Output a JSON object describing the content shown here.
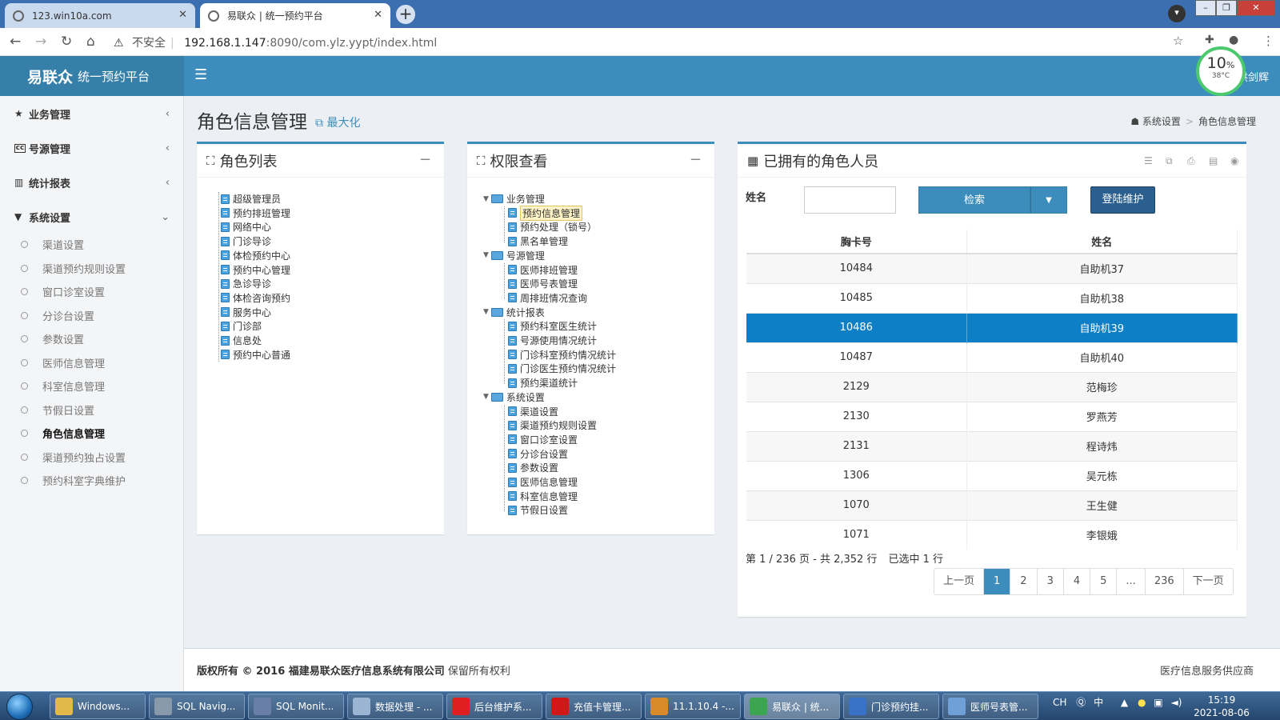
{
  "browser": {
    "tabs": [
      {
        "label": "123.win10a.com"
      },
      {
        "label": "易联众 | 统一预约平台"
      }
    ],
    "new_tab": "+",
    "security": "不安全",
    "url_host": "192.168.1.147",
    "url_path": ":8090/com.ylz.yypt/index.html"
  },
  "app": {
    "logo_bold": "易联众",
    "logo_sub": "统一预约平台",
    "user_name": "洪剑辉",
    "cpu_percent": "10",
    "cpu_percent_unit": "%",
    "cpu_temp": "38°C"
  },
  "sidebar": {
    "menus": [
      {
        "label": "业务管理",
        "icon": "star-icon"
      },
      {
        "label": "号源管理",
        "icon": "cc-icon"
      },
      {
        "label": "统计报表",
        "icon": "bar-chart-icon"
      },
      {
        "label": "系统设置",
        "icon": "filter-icon"
      }
    ],
    "submenu": [
      "渠道设置",
      "渠道预约规则设置",
      "窗口诊室设置",
      "分诊台设置",
      "参数设置",
      "医师信息管理",
      "科室信息管理",
      "节假日设置",
      "角色信息管理",
      "渠道预约独占设置",
      "预约科室字典维护"
    ],
    "active_submenu": "角色信息管理"
  },
  "page": {
    "title": "角色信息管理",
    "maximize": "最大化",
    "breadcrumb": [
      "系统设置",
      "角色信息管理"
    ]
  },
  "role_panel": {
    "title": "角色列表",
    "roles": [
      "超级管理员",
      "预约排班管理",
      "网络中心",
      "门诊导诊",
      "体检预约中心",
      "预约中心管理",
      "急诊导诊",
      "体检咨询预约",
      "服务中心",
      "门诊部",
      "信息处",
      "预约中心普通"
    ]
  },
  "perm_panel": {
    "title": "权限查看",
    "groups": [
      {
        "name": "业务管理",
        "items": [
          "预约信息管理",
          "预约处理（锁号）",
          "黑名单管理"
        ]
      },
      {
        "name": "号源管理",
        "items": [
          "医师排班管理",
          "医师号表管理",
          "周排班情况查询"
        ]
      },
      {
        "name": "统计报表",
        "items": [
          "预约科室医生统计",
          "号源使用情况统计",
          "门诊科室预约情况统计",
          "门诊医生预约情况统计",
          "预约渠道统计"
        ]
      },
      {
        "name": "系统设置",
        "items": [
          "渠道设置",
          "渠道预约规则设置",
          "窗口诊室设置",
          "分诊台设置",
          "参数设置",
          "医师信息管理",
          "科室信息管理",
          "节假日设置"
        ]
      }
    ],
    "highlighted": "预约信息管理"
  },
  "members_panel": {
    "title": "已拥有的角色人员",
    "name_label": "姓名",
    "name_value": "",
    "search_button": "检索",
    "maintain_button": "登陆维护",
    "columns": [
      "胸卡号",
      "姓名"
    ],
    "rows": [
      [
        "10484",
        "自助机37"
      ],
      [
        "10485",
        "自助机38"
      ],
      [
        "10486",
        "自助机39"
      ],
      [
        "10487",
        "自助机40"
      ],
      [
        "2129",
        "范梅珍"
      ],
      [
        "2130",
        "罗燕芳"
      ],
      [
        "2131",
        "程诗炜"
      ],
      [
        "1306",
        "吴元栋"
      ],
      [
        "1070",
        "王生健"
      ],
      [
        "1071",
        "李银娥"
      ]
    ],
    "selected_row": "10486",
    "page_info": "第 1 / 236 页 - 共 2,352 行",
    "selected_info": "已选中 1 行",
    "pager": [
      "上一页",
      "1",
      "2",
      "3",
      "4",
      "5",
      "...",
      "236",
      "下一页"
    ],
    "current_page": "1"
  },
  "footer": {
    "copyright": "版权所有 © 2016 福建易联众医疗信息系统有限公司",
    "rights": "保留所有权利",
    "right_text": "医疗信息服务供应商"
  },
  "taskbar": {
    "items": [
      {
        "label": "Windows...",
        "color": "#e0b94a"
      },
      {
        "label": "SQL Navig...",
        "color": "#8899aa"
      },
      {
        "label": "SQL Monit...",
        "color": "#6a7fa8"
      },
      {
        "label": "数据处理 - ...",
        "color": "#9ab4d2"
      },
      {
        "label": "后台维护系...",
        "color": "#e02020"
      },
      {
        "label": "充值卡管理...",
        "color": "#d01818"
      },
      {
        "label": "11.1.10.4 -...",
        "color": "#d98b2b"
      },
      {
        "label": "易联众 | 统...",
        "color": "#3ba550"
      },
      {
        "label": "门诊预约挂...",
        "color": "#3a72c8"
      },
      {
        "label": "医师号表管...",
        "color": "#6fa0d8"
      }
    ],
    "tray_lang": "CH",
    "tray_ime": "中",
    "time": "15:19",
    "date": "2021-08-06"
  }
}
